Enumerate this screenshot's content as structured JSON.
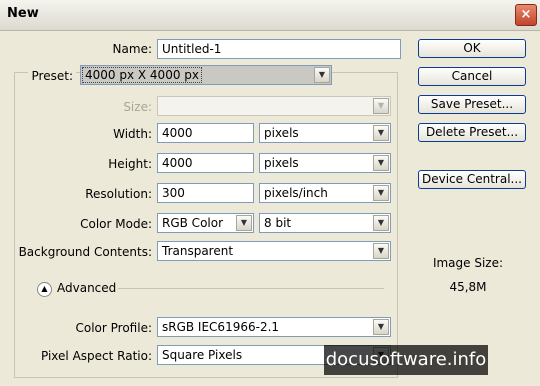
{
  "window": {
    "title": "New",
    "close_glyph": "×"
  },
  "form": {
    "name": {
      "label": "Name:",
      "value": "Untitled-1"
    },
    "preset": {
      "label": "Preset:",
      "value": "4000 px X 4000 px"
    },
    "size": {
      "label": "Size:",
      "value": ""
    },
    "width": {
      "label": "Width:",
      "value": "4000",
      "unit": "pixels"
    },
    "height": {
      "label": "Height:",
      "value": "4000",
      "unit": "pixels"
    },
    "resolution": {
      "label": "Resolution:",
      "value": "300",
      "unit": "pixels/inch"
    },
    "color_mode": {
      "label": "Color Mode:",
      "value": "RGB Color",
      "depth": "8 bit"
    },
    "background": {
      "label": "Background Contents:",
      "value": "Transparent"
    },
    "advanced": {
      "label": "Advanced",
      "icon": "chevron-up-icon"
    },
    "color_profile": {
      "label": "Color Profile:",
      "value": "sRGB IEC61966-2.1"
    },
    "pixel_aspect": {
      "label": "Pixel Aspect Ratio:",
      "value": "Square Pixels"
    }
  },
  "buttons": {
    "ok": "OK",
    "cancel": "Cancel",
    "save_preset": "Save Preset...",
    "delete_preset": "Delete Preset...",
    "device_central": "Device Central..."
  },
  "image_size": {
    "label": "Image Size:",
    "value": "45,8M"
  },
  "watermark": "docusoftware.info",
  "dropdown_arrow": "▼",
  "advanced_glyph": "▲"
}
